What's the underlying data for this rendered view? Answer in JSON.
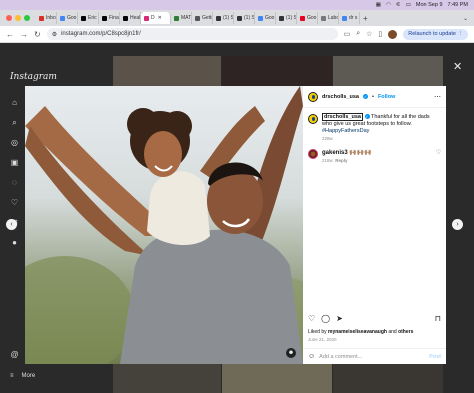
{
  "menubar": {
    "date": "Mon Sep 9",
    "time": "7:49 PM"
  },
  "tabs": [
    {
      "label": "Inbo",
      "icon": "mail-icon",
      "color": "#d93025"
    },
    {
      "label": "Goo",
      "icon": "docs-icon",
      "color": "#4285f4"
    },
    {
      "label": "Eric",
      "icon": "x-icon",
      "color": "#000000"
    },
    {
      "label": "Fina",
      "icon": "x-icon",
      "color": "#000000"
    },
    {
      "label": "Heal",
      "icon": "x-icon",
      "color": "#000000"
    },
    {
      "label": "D",
      "icon": "instagram-icon",
      "color": "#d62976",
      "active": true
    },
    {
      "label": "MAT",
      "icon": "grid-icon",
      "color": "#2e7d32"
    },
    {
      "label": "Getti",
      "icon": "link-icon",
      "color": "#555555"
    },
    {
      "label": "(1) S",
      "icon": "square-icon",
      "color": "#333333"
    },
    {
      "label": "(1) S",
      "icon": "square-icon",
      "color": "#333333"
    },
    {
      "label": "Goo",
      "icon": "docs-icon",
      "color": "#4285f4"
    },
    {
      "label": "(1) S",
      "icon": "square-icon",
      "color": "#333333"
    },
    {
      "label": "Goo",
      "icon": "pinterest-icon",
      "color": "#e60023"
    },
    {
      "label": "Labo",
      "icon": "globe-icon",
      "color": "#777777"
    },
    {
      "label": "dr s",
      "icon": "google-icon",
      "color": "#4285f4"
    }
  ],
  "address": {
    "url": "instagram.com/p/C8spc8jn1fr/"
  },
  "relaunch_label": "Relaunch to update",
  "instagram": {
    "logo": "Instagram",
    "more_label": "More"
  },
  "post": {
    "username": "drscholls_usa",
    "follow_label": "Follow",
    "caption_user": "drscholls_usa",
    "caption_text": "Thankful for all the dads who give us great footsteps to follow.",
    "hashtag": "#HappyFathersDay",
    "caption_time": "228w",
    "comment_user": "gakenis3",
    "comment_text": "🙌🏽🙌🏽🙌🏽",
    "comment_time": "218w",
    "reply_label": "Reply",
    "liked_by_prefix": "Liked by",
    "liked_by_user": "mynameiseliseavanaugh",
    "liked_by_mid": "and",
    "liked_by_others": "others",
    "date": "June 21, 2020",
    "add_comment_placeholder": "Add a comment...",
    "post_label": "Post"
  },
  "colors": {
    "follow": "#0095f6",
    "brand_yellow": "#f5d000"
  }
}
